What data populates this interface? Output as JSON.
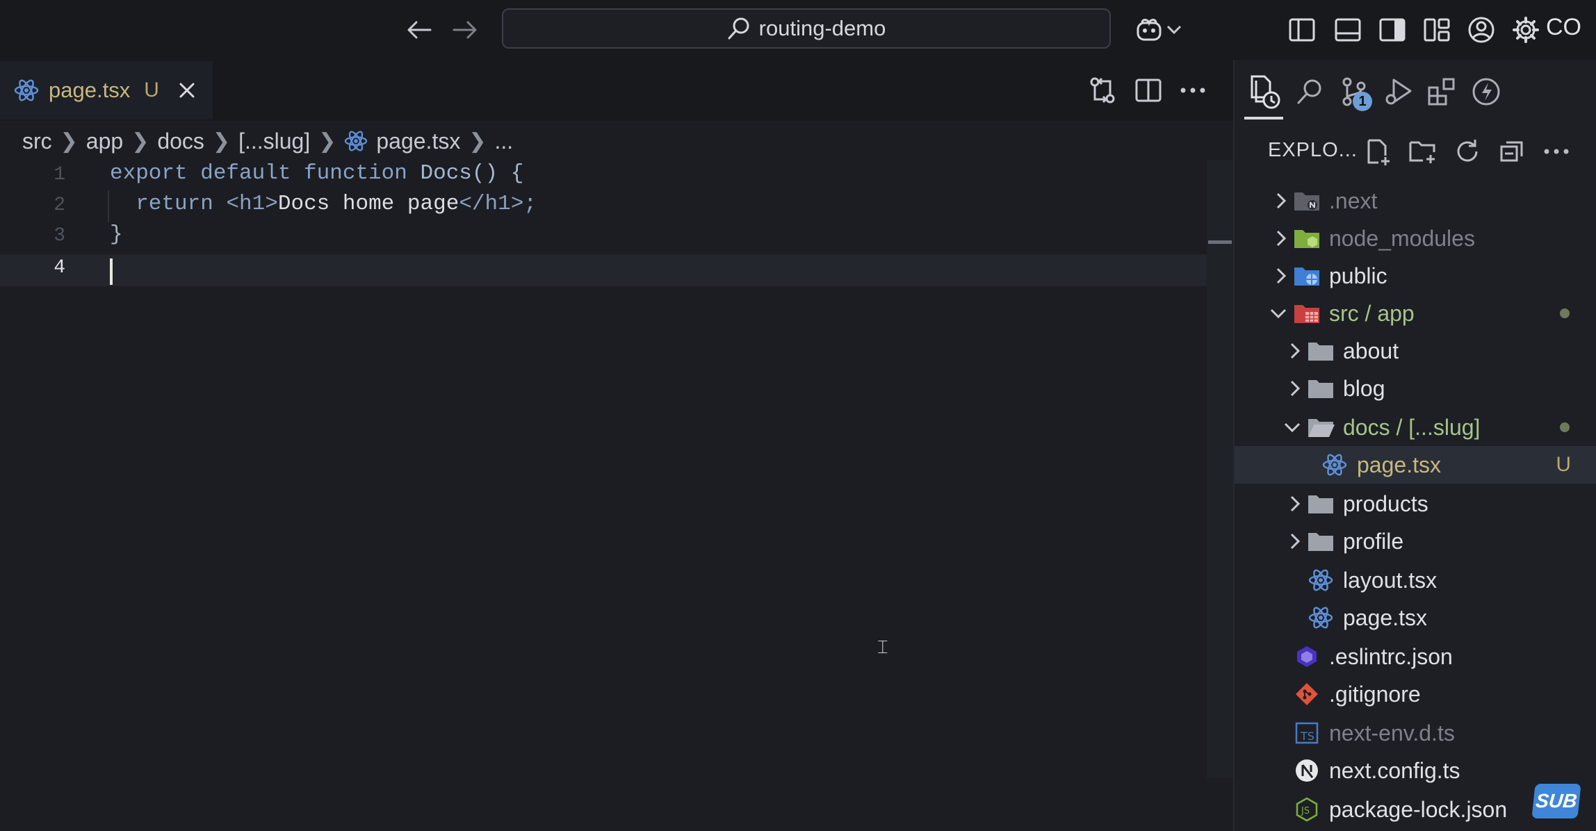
{
  "titlebar": {
    "search_text": "routing-demo",
    "profile_label": "CO"
  },
  "editor": {
    "tab": {
      "label": "page.tsx",
      "status": "U"
    },
    "breadcrumb": {
      "items": [
        "src",
        "app",
        "docs",
        "[...slug]",
        "page.tsx",
        "..."
      ]
    },
    "gutter": [
      "1",
      "2",
      "3",
      "4"
    ],
    "code": {
      "line1_kw": "export default function ",
      "line1_fn": "Docs() {",
      "line2_kw": "  return ",
      "line2_open": "<h1>",
      "line2_text": "Docs home page",
      "line2_close": "</h1>;",
      "line3": "}"
    }
  },
  "explorer": {
    "title": "EXPLO...",
    "scm_badge": "1",
    "tree": [
      {
        "label": ".next"
      },
      {
        "label": "node_modules"
      },
      {
        "label": "public"
      },
      {
        "label": "src / app"
      },
      {
        "label": "about"
      },
      {
        "label": "blog"
      },
      {
        "label": "docs / [...slug]"
      },
      {
        "label": "page.tsx",
        "status": "U"
      },
      {
        "label": "products"
      },
      {
        "label": "profile"
      },
      {
        "label": "layout.tsx"
      },
      {
        "label": "page.tsx"
      },
      {
        "label": ".eslintrc.json"
      },
      {
        "label": ".gitignore"
      },
      {
        "label": "next-env.d.ts"
      },
      {
        "label": "next.config.ts"
      },
      {
        "label": "package-lock.json"
      }
    ]
  },
  "overlay": {
    "sub_badge": "SUB"
  },
  "colors": {
    "accent": "#6d9fd6",
    "modified": "#b8a86f",
    "background": "#1b1d22"
  },
  "icons": [
    "arrow-left-icon",
    "arrow-right-icon",
    "search-icon",
    "copilot-icon",
    "react-icon",
    "folder-icon",
    "git-icon",
    "gear-icon",
    "account-icon"
  ]
}
